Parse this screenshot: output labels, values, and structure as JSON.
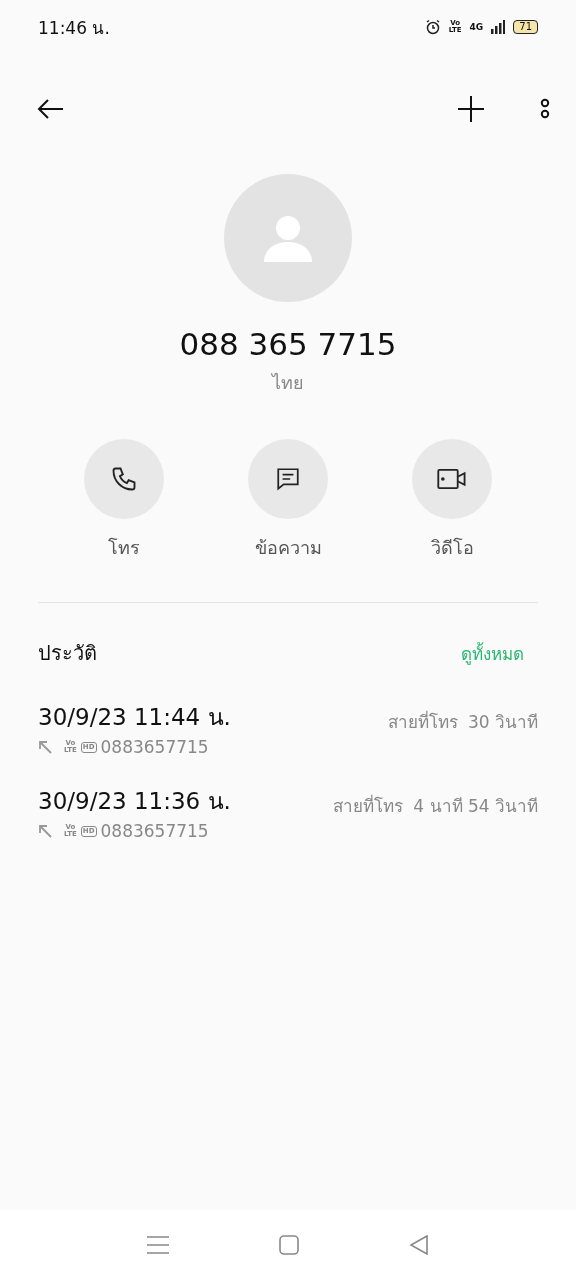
{
  "status_bar": {
    "time": "11:46 น.",
    "network": "4G",
    "volte": "Vo LTE",
    "battery": "71"
  },
  "contact": {
    "number": "088 365 7715",
    "location": "ไทย"
  },
  "actions": [
    {
      "kind": "call",
      "label": "โทร"
    },
    {
      "kind": "message",
      "label": "ข้อความ"
    },
    {
      "kind": "video",
      "label": "วิดีโอ"
    }
  ],
  "history": {
    "title": "ประวัติ",
    "see_all": "ดูทั้งหมด",
    "entries": [
      {
        "datetime": "30/9/23 11:44 น.",
        "volte": "Vo LTE",
        "hd": "HD",
        "number": "0883657715",
        "type": "สายที่โทร",
        "duration": "30 วินาที"
      },
      {
        "datetime": "30/9/23 11:36 น.",
        "volte": "Vo LTE",
        "hd": "HD",
        "number": "0883657715",
        "type": "สายที่โทร",
        "duration": "4 นาที 54 วินาที"
      }
    ]
  }
}
